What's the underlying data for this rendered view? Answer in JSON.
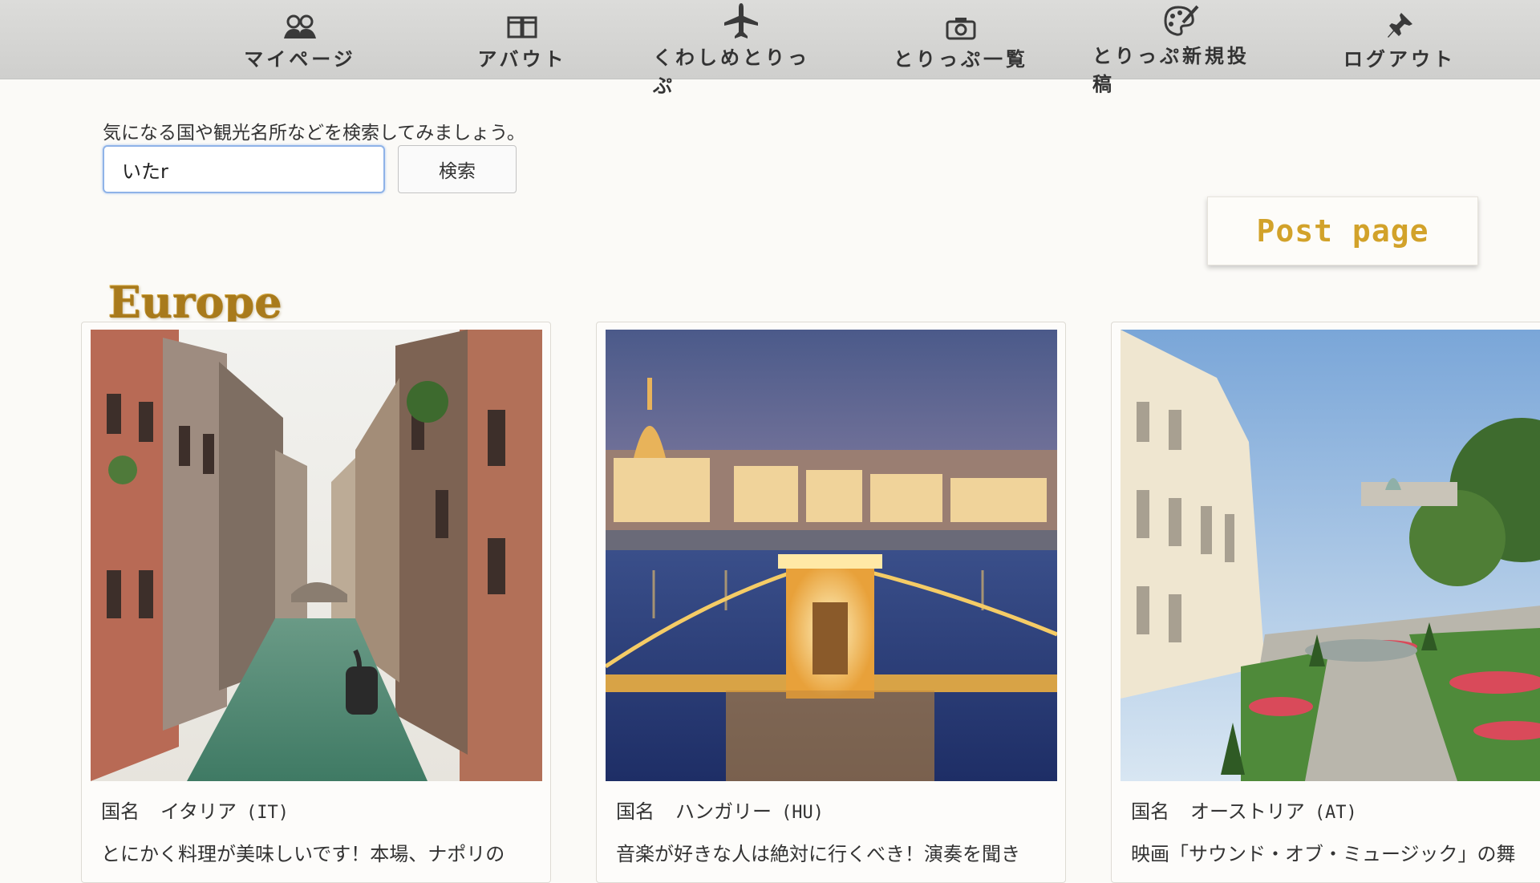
{
  "nav": {
    "items": [
      {
        "label": "マイページ",
        "icon": "users-icon"
      },
      {
        "label": "アバウト",
        "icon": "book-icon"
      },
      {
        "label": "くわしめとりっぷ",
        "icon": "airplane-icon"
      },
      {
        "label": "とりっぷ一覧",
        "icon": "camera-icon"
      },
      {
        "label": "とりっぷ新規投稿",
        "icon": "palette-icon"
      },
      {
        "label": "ログアウト",
        "icon": "pushpin-icon"
      }
    ]
  },
  "search": {
    "prompt": "気になる国や観光名所などを検索してみましょう。",
    "value": "いたr",
    "button_label": "検索"
  },
  "post_page": {
    "label": "Post page"
  },
  "region": {
    "title": "Europe"
  },
  "cards": [
    {
      "country_label": "国名",
      "country": "イタリア",
      "code": "(IT)",
      "description": "とにかく料理が美味しいです！本場、ナポリの",
      "photo": "venice-canal-photo"
    },
    {
      "country_label": "国名",
      "country": "ハンガリー",
      "code": "(HU)",
      "description": "音楽が好きな人は絶対に行くべき！演奏を聞き",
      "photo": "budapest-chain-bridge-photo"
    },
    {
      "country_label": "国名",
      "country": "オーストリア",
      "code": "(AT)",
      "description": "映画「サウンド・オブ・ミュージック」の舞",
      "photo": "salzburg-mirabell-garden-photo"
    }
  ],
  "colors": {
    "accent_gold": "#c9962a",
    "input_focus": "#8fb3e8",
    "nav_bg": "#d4d4d2"
  }
}
